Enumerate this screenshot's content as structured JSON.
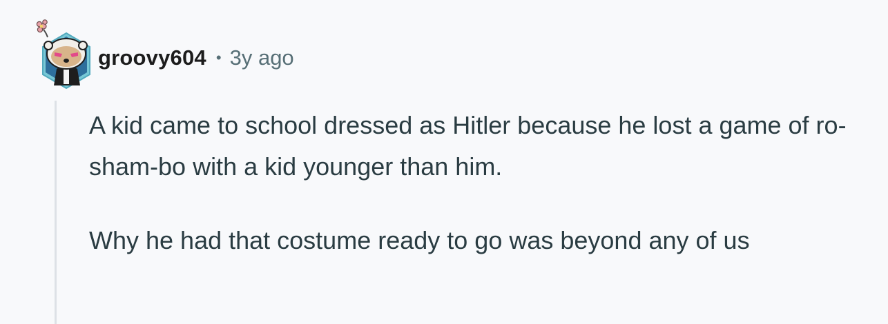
{
  "comment": {
    "author": "groovy604",
    "separator": "•",
    "age": "3y ago",
    "avatar": "snoo-avatar-with-flower-icon",
    "paragraphs": [
      "A kid came to school dressed as Hitler because he lost a game of ro-sham-bo with a kid younger than him.",
      "Why he had that costume ready to go was beyond any of us"
    ]
  },
  "colors": {
    "background": "#f8f9fb",
    "username": "#1c1c1c",
    "meta": "#576f76",
    "body_text": "#2a3c42",
    "thread_line": "#dde1e6",
    "avatar_hex": "#5ab3c4"
  }
}
